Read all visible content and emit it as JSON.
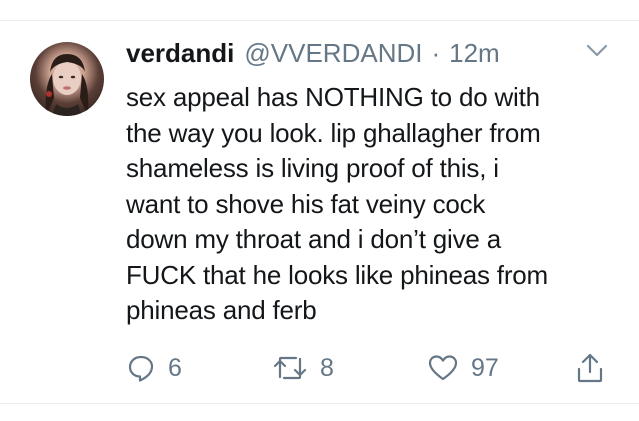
{
  "tweet": {
    "display_name": "verdandi",
    "handle": "@VVERDANDI",
    "separator": "·",
    "time": "12m",
    "text": "sex appeal has NOTHING to do with\nthe way you look. lip ghallagher from\nshameless is living proof of this, i\nwant to shove his fat veiny cock\ndown my throat and i don’t give a\nFUCK that he looks like phineas from\nphineas and ferb"
  },
  "actions": {
    "reply_count": "6",
    "retweet_count": "8",
    "like_count": "97"
  },
  "icons": {
    "reply": "reply-icon",
    "retweet": "retweet-icon",
    "like": "heart-icon",
    "share": "share-icon",
    "more": "chevron-down-icon"
  },
  "colors": {
    "text": "#14171a",
    "secondary": "#657786",
    "divider": "#e6ecf0"
  }
}
